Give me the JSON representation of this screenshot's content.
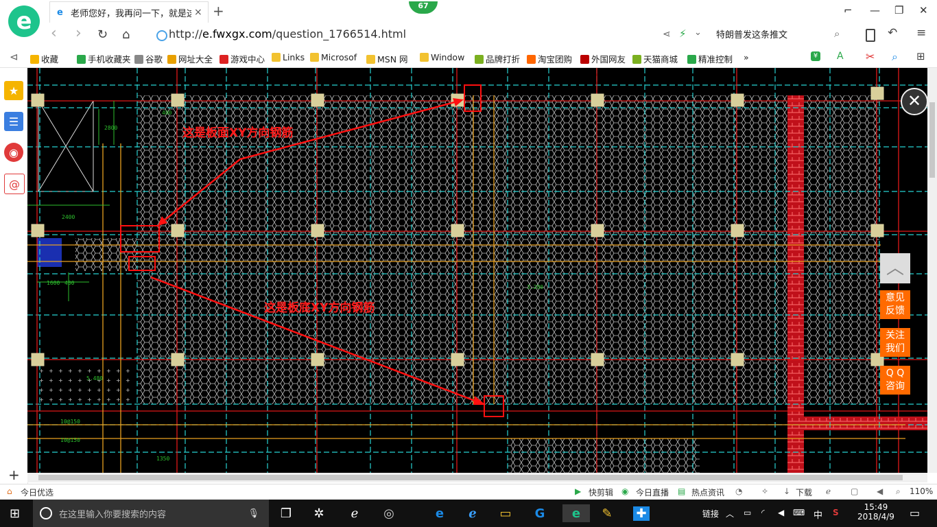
{
  "tab": {
    "title": "老师您好，我再问一下，就是这些",
    "close": "×",
    "new": "+"
  },
  "badge": "67",
  "window": {
    "pin": "⌐",
    "min": "—",
    "max": "❐",
    "close": "✕"
  },
  "nav": {
    "back": "‹",
    "forward": "›",
    "refresh": "↻",
    "home": "⌂"
  },
  "address": {
    "prefix": "http://",
    "domain": "e.fwxgx.com",
    "path": "/question_1766514.html"
  },
  "search": {
    "text": "特朗普发这条推文"
  },
  "bookmarks": [
    {
      "label": "收藏",
      "icon": "star-icon",
      "color": "#f5b400"
    },
    {
      "label": "手机收藏夹",
      "icon": "phone-icon",
      "color": "#2aa84a"
    },
    {
      "label": "谷歌",
      "icon": "page-icon",
      "color": "#888"
    },
    {
      "label": "网址大全",
      "icon": "globe-icon",
      "color": "#e8a000"
    },
    {
      "label": "游戏中心",
      "icon": "game-icon",
      "color": "#d22"
    },
    {
      "label": "Links",
      "icon": "folder-icon",
      "color": "#f2c230"
    },
    {
      "label": "Microsof",
      "icon": "folder-icon",
      "color": "#f2c230"
    },
    {
      "label": "MSN 网",
      "icon": "folder-icon",
      "color": "#f2c230"
    },
    {
      "label": "Window",
      "icon": "folder-icon",
      "color": "#f2c230"
    },
    {
      "label": "品牌打折",
      "icon": "leaf-icon",
      "color": "#7bb020"
    },
    {
      "label": "淘宝团购",
      "icon": "taobao-icon",
      "color": "#f60"
    },
    {
      "label": "外国网友",
      "icon": "bookmark-icon",
      "color": "#b00"
    },
    {
      "label": "天猫商城",
      "icon": "leaf-icon",
      "color": "#7bb020"
    },
    {
      "label": "精准控制",
      "icon": "wechat-icon",
      "color": "#2aa84a"
    }
  ],
  "bm_more": "»",
  "cad": {
    "annotation_top": "这是板面XY方向钢筋",
    "annotation_bottom": "这是板底XY方向钢筋",
    "dim_labels": [
      "400",
      "2800",
      "2400",
      "1600",
      "400",
      "1350",
      "5.480",
      "10@150",
      "10@150",
      "3.280"
    ]
  },
  "side": {
    "close": "✕",
    "totop": "︿",
    "feedback": [
      "意见",
      "反馈"
    ],
    "follow": [
      "关注",
      "我们"
    ],
    "qq": [
      "Q Q",
      "咨询"
    ],
    "add": "+"
  },
  "status": {
    "left": "今日优选",
    "items": [
      "快剪辑",
      "今日直播",
      "热点资讯",
      "下载"
    ],
    "zoom": "110%"
  },
  "taskbar": {
    "search_placeholder": "在这里输入你要搜索的内容",
    "tray_label": "链接",
    "ime": "中",
    "time": "15:49",
    "date": "2018/4/9"
  }
}
